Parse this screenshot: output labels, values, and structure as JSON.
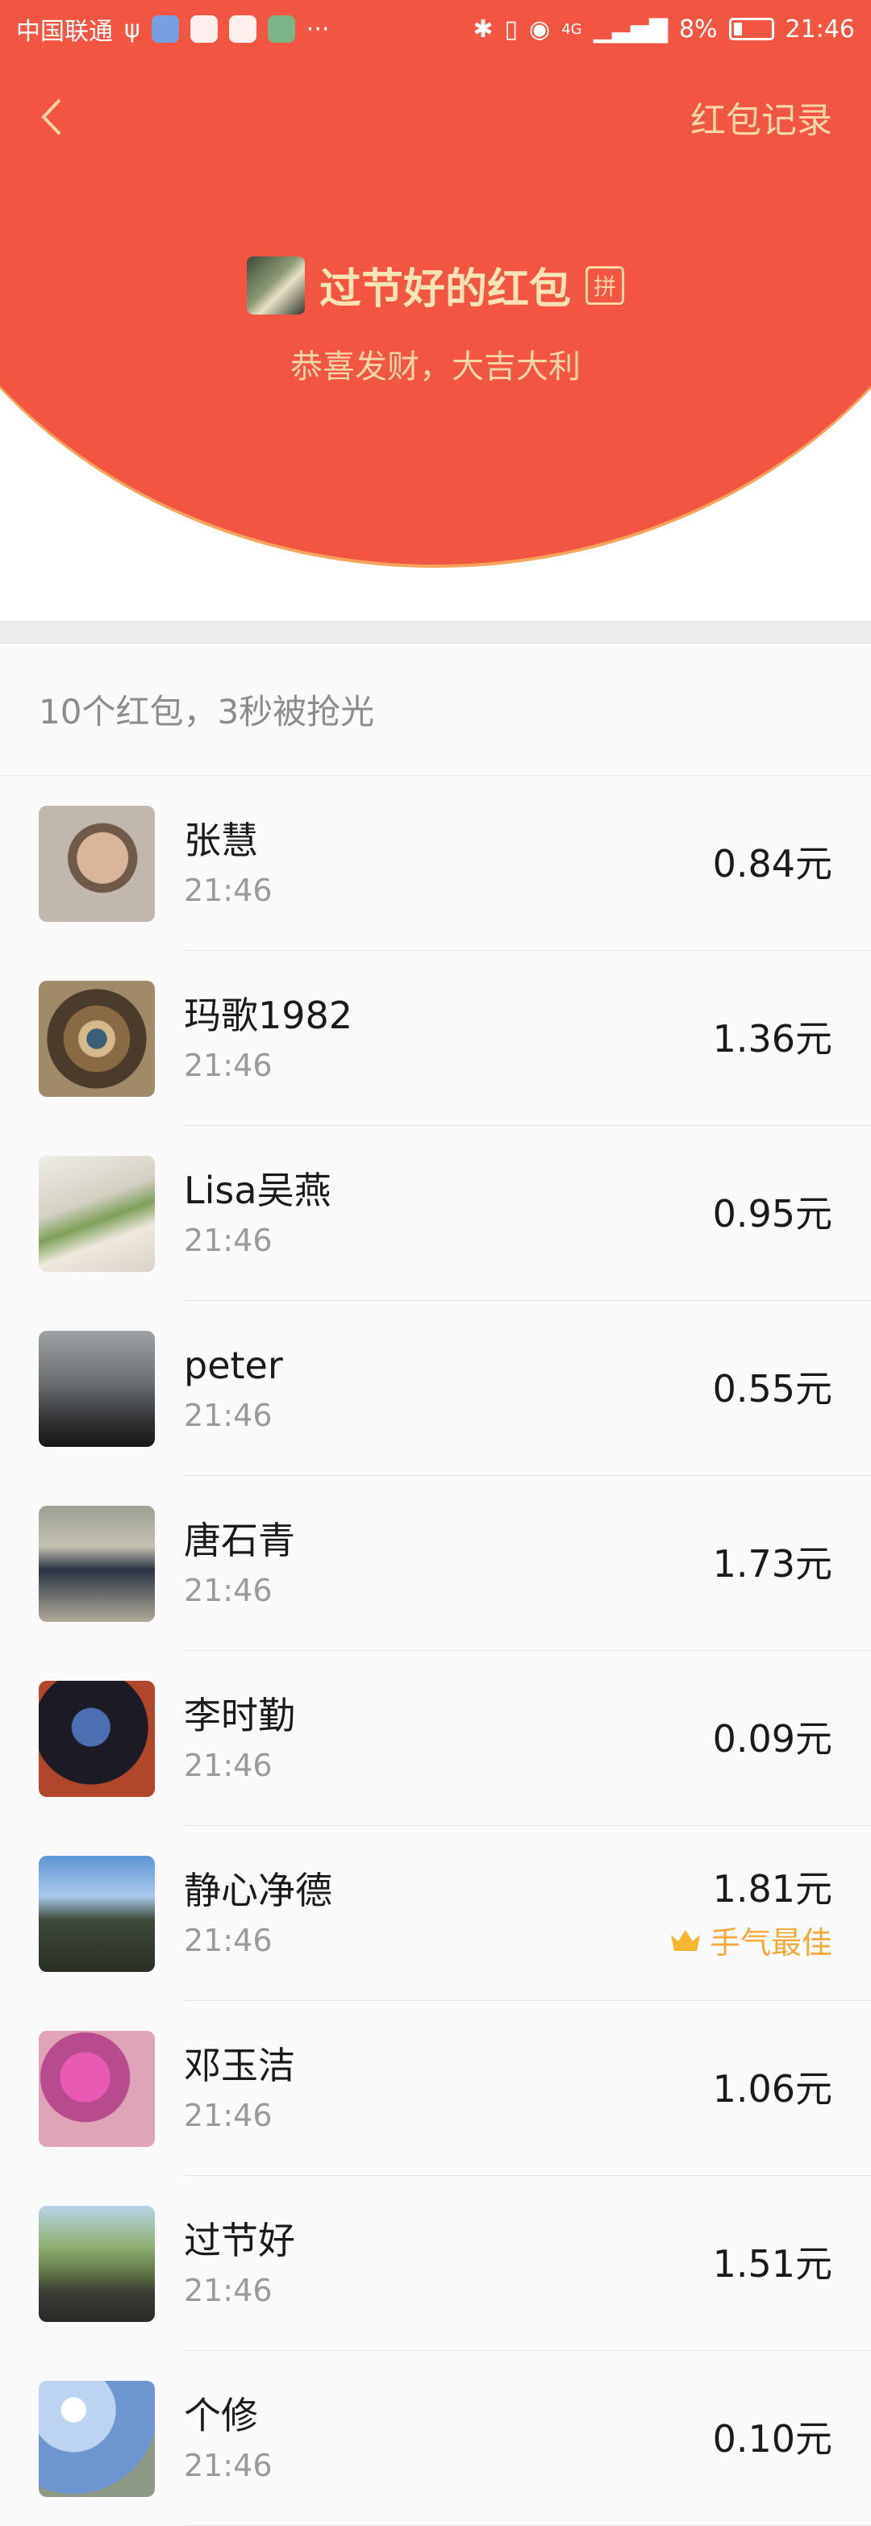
{
  "status_bar": {
    "carrier": "中国联通",
    "battery": "8%",
    "network": "4G",
    "time": "21:46"
  },
  "nav": {
    "back_icon": "chevron-left-icon",
    "record_link": "红包记录"
  },
  "packet": {
    "title": "过节好的红包",
    "badge": "拼",
    "greeting": "恭喜发财，大吉大利"
  },
  "list": {
    "summary": "10个红包，3秒被抢光",
    "best_label": "手气最佳",
    "rows": [
      {
        "name": "张慧",
        "time": "21:46",
        "amount": "0.84元"
      },
      {
        "name": "玛歌1982",
        "time": "21:46",
        "amount": "1.36元"
      },
      {
        "name": "Lisa吴燕",
        "time": "21:46",
        "amount": "0.95元"
      },
      {
        "name": "peter",
        "time": "21:46",
        "amount": "0.55元"
      },
      {
        "name": "唐石青",
        "time": "21:46",
        "amount": "1.73元"
      },
      {
        "name": "李时勤",
        "time": "21:46",
        "amount": "0.09元"
      },
      {
        "name": "静心净德",
        "time": "21:46",
        "amount": "1.81元"
      },
      {
        "name": "邓玉洁",
        "time": "21:46",
        "amount": "1.06元"
      },
      {
        "name": "过节好",
        "time": "21:46",
        "amount": "1.51元"
      },
      {
        "name": "个修",
        "time": "21:46",
        "amount": "0.10元"
      }
    ]
  },
  "colors": {
    "header_red": "#f25643",
    "gold_text": "#fbd7a8",
    "best_orange": "#f4a93a"
  }
}
